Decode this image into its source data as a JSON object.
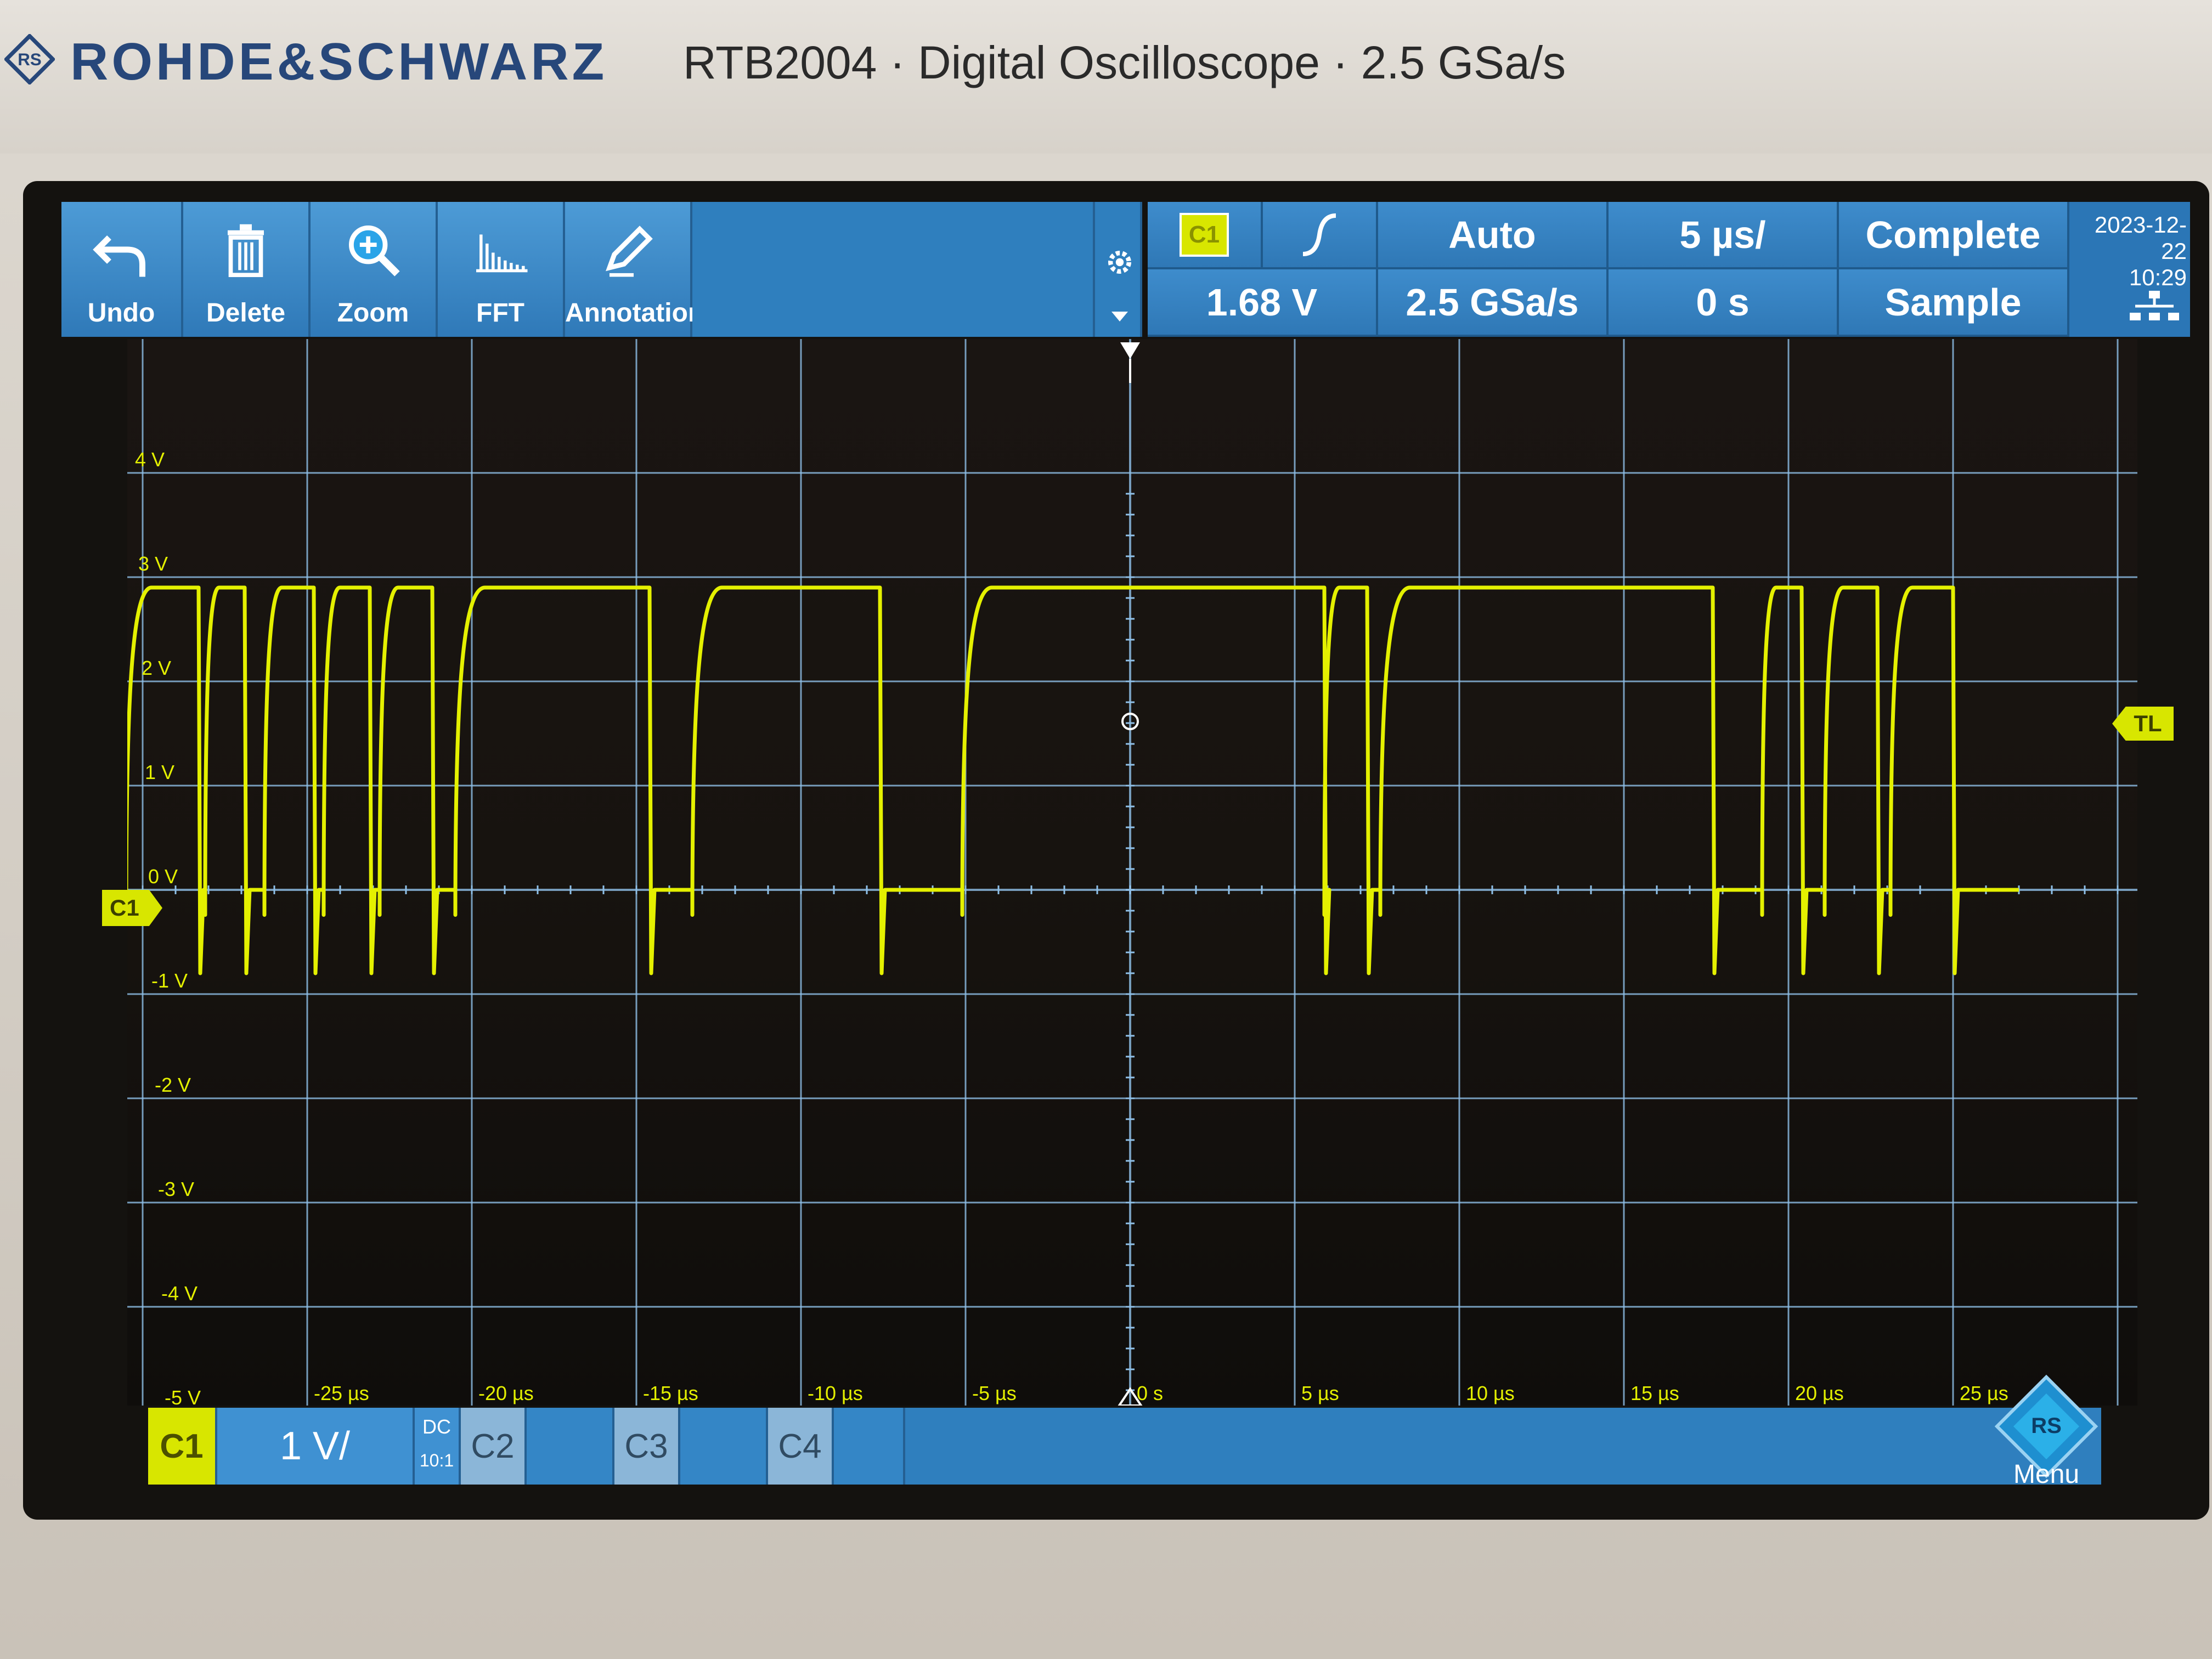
{
  "header": {
    "brand": "ROHDE&SCHWARZ",
    "model_line": "RTB2004 · Digital Oscilloscope · 2.5 GSa/s"
  },
  "toolbar": {
    "buttons": [
      {
        "label": "Undo",
        "icon": "undo-icon"
      },
      {
        "label": "Delete",
        "icon": "trash-icon"
      },
      {
        "label": "Zoom",
        "icon": "zoom-icon"
      },
      {
        "label": "FFT",
        "icon": "fft-icon"
      },
      {
        "label": "Annotation",
        "icon": "pencil-icon"
      }
    ]
  },
  "status": {
    "trigger_source": "C1",
    "trigger_slope": "rising-edge",
    "trigger_level": "1.68 V",
    "trigger_mode": "Auto",
    "sample_rate": "2.5 GSa/s",
    "timebase": "5 µs/",
    "trigger_offset": "0 s",
    "acquisition": "Complete",
    "acq_mode": "Sample",
    "date": "2023-12-22",
    "time": "10:29"
  },
  "screen": {
    "volt_labels": [
      "4 V",
      "3 V",
      "2 V",
      "1 V",
      "0 V",
      "-1 V",
      "-2 V",
      "-3 V",
      "-4 V",
      "-5 V"
    ],
    "time_labels": [
      "-25 µs",
      "-20 µs",
      "-15 µs",
      "-10 µs",
      "-5 µs",
      "0 s",
      "5 µs",
      "10 µs",
      "15 µs",
      "20 µs",
      "25 µs"
    ],
    "channel_marker": "C1",
    "trigger_level_marker": "TL"
  },
  "bottom": {
    "ch1_label": "C1",
    "ch1_scale": "1 V/",
    "ch1_coupling": "DC",
    "ch1_probe": "10:1",
    "ch2_label": "C2",
    "ch3_label": "C3",
    "ch4_label": "C4",
    "menu_label": "Menu"
  },
  "colors": {
    "trace": "#e4f000",
    "ui_blue": "#2f7fbe",
    "grid": "#8fc0e8"
  },
  "signal": {
    "units_x": "µs",
    "units_y": "V",
    "high_level_v": 2.9,
    "low_level_v": 0.0,
    "undershoot_v": -0.8,
    "high_intervals_us": [
      [
        -30.5,
        -28.3
      ],
      [
        -28.1,
        -26.9
      ],
      [
        -26.3,
        -24.8
      ],
      [
        -24.5,
        -23.1
      ],
      [
        -22.8,
        -21.2
      ],
      [
        -20.5,
        -14.6
      ],
      [
        -13.3,
        -7.6
      ],
      [
        -5.1,
        5.9
      ],
      [
        5.9,
        7.2
      ],
      [
        7.6,
        17.7
      ],
      [
        19.2,
        20.4
      ],
      [
        21.1,
        22.7
      ],
      [
        23.1,
        25.0
      ]
    ]
  }
}
